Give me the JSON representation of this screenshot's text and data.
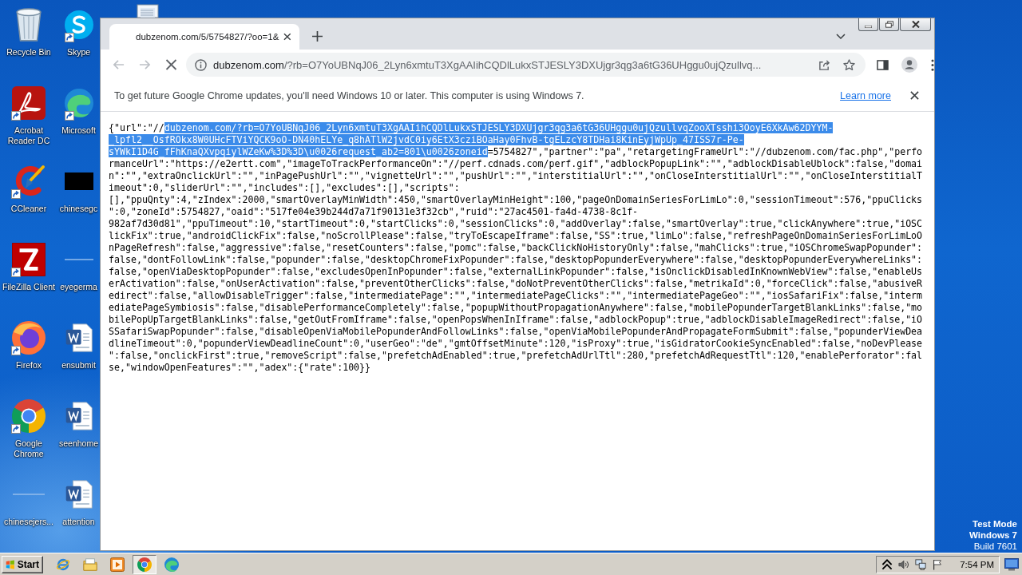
{
  "desktop": {
    "icons": [
      {
        "label": "Recycle Bin",
        "kind": "bin",
        "shortcut": false
      },
      {
        "label": "Acrobat Reader DC",
        "kind": "pdf",
        "shortcut": true
      },
      {
        "label": "CCleaner",
        "kind": "cleaner",
        "shortcut": true
      },
      {
        "label": "FileZilla Client",
        "kind": "ftp",
        "shortcut": true
      },
      {
        "label": "Firefox",
        "kind": "firefox",
        "shortcut": true
      },
      {
        "label": "Google Chrome",
        "kind": "chrome",
        "shortcut": true
      },
      {
        "label": "chinesejers...",
        "kind": "blank",
        "shortcut": false
      },
      {
        "label": "Skype",
        "kind": "skype",
        "shortcut": true
      },
      {
        "label": "Microsoft",
        "kind": "edge",
        "shortcut": true
      },
      {
        "label": "chinesegc",
        "kind": "thumbnail",
        "shortcut": false
      },
      {
        "label": "eyegerma",
        "kind": "blank",
        "shortcut": false
      },
      {
        "label": "ensubmit",
        "kind": "word",
        "shortcut": false
      },
      {
        "label": "seenhome",
        "kind": "word",
        "shortcut": false
      },
      {
        "label": "attention",
        "kind": "word",
        "shortcut": false
      }
    ],
    "notice": [
      "Test Mode",
      "Windows 7",
      "Build 7601"
    ]
  },
  "browser": {
    "tabs": [
      {
        "title": "dubzenom.com/5/5754827/?oo=1&",
        "selected": true
      }
    ],
    "toolbar": {
      "back_disabled": true,
      "forward_disabled": true,
      "loading": true,
      "bookmarked": false
    },
    "address": {
      "host": "dubzenom.com",
      "path": "/?rb=O7YoUBNqJ06_2Lyn6xmtuT3XgAAIihCQDlLukxSTJESLY3DXUjgr3qg3a6tG36UHggu0ujQzullvq..."
    },
    "infobar": {
      "message": "To get future Google Chrome updates, you'll need Windows 10 or later. This computer is using Windows 7.",
      "link": "Learn more"
    },
    "document": {
      "lines": [
        {
          "segments": [
            {
              "text": "{\"url\":\"//",
              "selected": false
            },
            {
              "text": "dubzenom.com/?rb=O7YoUBNqJ06_2Lyn6xmtuT3XgAAIihCQDlLukxSTJESLY3DXUjgr3qg3a6tG36UHggu0ujQzullvqZooXTsshi3OoyE6XkAw62DYYM-",
              "selected": true
            }
          ]
        },
        {
          "segments": [
            {
              "text": "_lpfl2__OsfROkx8W0UHcFTViYQCK9oO-DN40hELYe_q8hATlW2jvdC0iy6EtX3cziBOaHay0FhvB-tgELzcY8TDHai8KinEyjWpUp_47ISS7r-Pe-",
              "selected": true
            }
          ]
        },
        {
          "segments": [
            {
              "text": "sYWkI1D4G_fFhKnaQXvpqiylWZeKw%3D%3D\\u0026request_ab2=801\\u0026zoneid",
              "selected": true
            },
            {
              "text": "=5754827\",\"partner\":\"pa\",\"retargetingFrameUrl\":\"//dubzenom.com/fac.php\",\"perfo",
              "selected": false
            }
          ]
        },
        {
          "segments": [
            {
              "text": "rmanceUrl\":\"https://e2ertt.com\",\"imageToTrackPerformanceOn\":\"//perf.cdnads.com/perf.gif\",\"adblockPopupLink\":\"\",\"adblockDisableUblock\":false,\"domai",
              "selected": false
            }
          ]
        },
        {
          "segments": [
            {
              "text": "n\":\"\",\"extraOnclickUrl\":\"\",\"inPagePushUrl\":\"\",\"vignetteUrl\":\"\",\"pushUrl\":\"\",\"interstitialUrl\":\"\",\"onCloseInterstitialUrl\":\"\",\"onCloseInterstitialT",
              "selected": false
            }
          ]
        },
        {
          "segments": [
            {
              "text": "imeout\":0,\"sliderUrl\":\"\",\"includes\":[],\"excludes\":[],\"scripts\":",
              "selected": false
            }
          ]
        },
        {
          "segments": [
            {
              "text": "[],\"ppuQnty\":4,\"zIndex\":2000,\"smartOverlayMinWidth\":450,\"smartOverlayMinHeight\":100,\"pageOnDomainSeriesForLimLo\":0,\"sessionTimeout\":576,\"ppuClicks",
              "selected": false
            }
          ]
        },
        {
          "segments": [
            {
              "text": "\":0,\"zoneId\":5754827,\"oaid\":\"517fe04e39b244d7a71f90131e3f32cb\",\"ruid\":\"27ac4501-fa4d-4738-8c1f-",
              "selected": false
            }
          ]
        },
        {
          "segments": [
            {
              "text": "982af7d30d81\",\"ppuTimeout\":10,\"startTimeout\":0,\"startClicks\":0,\"sessionClicks\":0,\"addOverlay\":false,\"smartOverlay\":true,\"clickAnywhere\":true,\"iOSC",
              "selected": false
            }
          ]
        },
        {
          "segments": [
            {
              "text": "lickFix\":true,\"androidClickFix\":false,\"noScrollPlease\":false,\"tryToEscapeIframe\":false,\"SS\":true,\"limLo\":false,\"refreshPageOnDomainSeriesForLimLoO",
              "selected": false
            }
          ]
        },
        {
          "segments": [
            {
              "text": "nPageRefresh\":false,\"aggressive\":false,\"resetCounters\":false,\"pomc\":false,\"backClickNoHistoryOnly\":false,\"mahClicks\":true,\"iOSChromeSwapPopunder\":",
              "selected": false
            }
          ]
        },
        {
          "segments": [
            {
              "text": "false,\"dontFollowLink\":false,\"popunder\":false,\"desktopChromeFixPopunder\":false,\"desktopPopunderEverywhere\":false,\"desktopPopunderEverywhereLinks\":",
              "selected": false
            }
          ]
        },
        {
          "segments": [
            {
              "text": "false,\"openViaDesktopPopunder\":false,\"excludesOpenInPopunder\":false,\"externalLinkPopunder\":false,\"isOnclickDisabledInKnownWebView\":false,\"enableUs",
              "selected": false
            }
          ]
        },
        {
          "segments": [
            {
              "text": "erActivation\":false,\"onUserActivation\":false,\"preventOtherClicks\":false,\"doNotPreventOtherClicks\":false,\"metrikaId\":0,\"forceClick\":false,\"abusiveR",
              "selected": false
            }
          ]
        },
        {
          "segments": [
            {
              "text": "edirect\":false,\"allowDisableTrigger\":false,\"intermediatePage\":\"\",\"intermediatePageClicks\":\"\",\"intermediatePageGeo\":\"\",\"iosSafariFix\":false,\"interm",
              "selected": false
            }
          ]
        },
        {
          "segments": [
            {
              "text": "ediatePageSymbiosis\":false,\"disablePerformanceCompletely\":false,\"popupWithoutPropagationAnywhere\":false,\"mobilePopunderTargetBlankLinks\":false,\"mo",
              "selected": false
            }
          ]
        },
        {
          "segments": [
            {
              "text": "bilePopUpTargetBlankLinks\":false,\"getOutFromIframe\":false,\"openPopsWhenInIframe\":false,\"adblockPopup\":true,\"adblockDisableImageRedirect\":false,\"iO",
              "selected": false
            }
          ]
        },
        {
          "segments": [
            {
              "text": "SSafariSwapPopunder\":false,\"disableOpenViaMobilePopunderAndFollowLinks\":false,\"openViaMobilePopunderAndPropagateFormSubmit\":false,\"popunderViewDea",
              "selected": false
            }
          ]
        },
        {
          "segments": [
            {
              "text": "dlineTimeout\":0,\"popunderViewDeadlineCount\":0,\"userGeo\":\"de\",\"gmtOffsetMinute\":120,\"isProxy\":true,\"isGidratorCookieSyncEnabled\":false,\"noDevPlease",
              "selected": false
            }
          ]
        },
        {
          "segments": [
            {
              "text": "\":false,\"onclickFirst\":true,\"removeScript\":false,\"prefetchAdEnabled\":true,\"prefetchAdUrlTtl\":280,\"prefetchAdRequestTtl\":120,\"enablePerforator\":fal",
              "selected": false
            }
          ]
        },
        {
          "segments": [
            {
              "text": "se,\"windowOpenFeatures\":\"\",\"adex\":{\"rate\":100}}",
              "selected": false
            }
          ]
        }
      ]
    }
  },
  "taskbar": {
    "start": "Start",
    "items": [
      {
        "kind": "ie",
        "selected": false
      },
      {
        "kind": "folder",
        "selected": false
      },
      {
        "kind": "media",
        "selected": false
      },
      {
        "kind": "chrome",
        "selected": true
      },
      {
        "kind": "edge",
        "selected": false
      }
    ],
    "clock": "7:54 PM"
  }
}
